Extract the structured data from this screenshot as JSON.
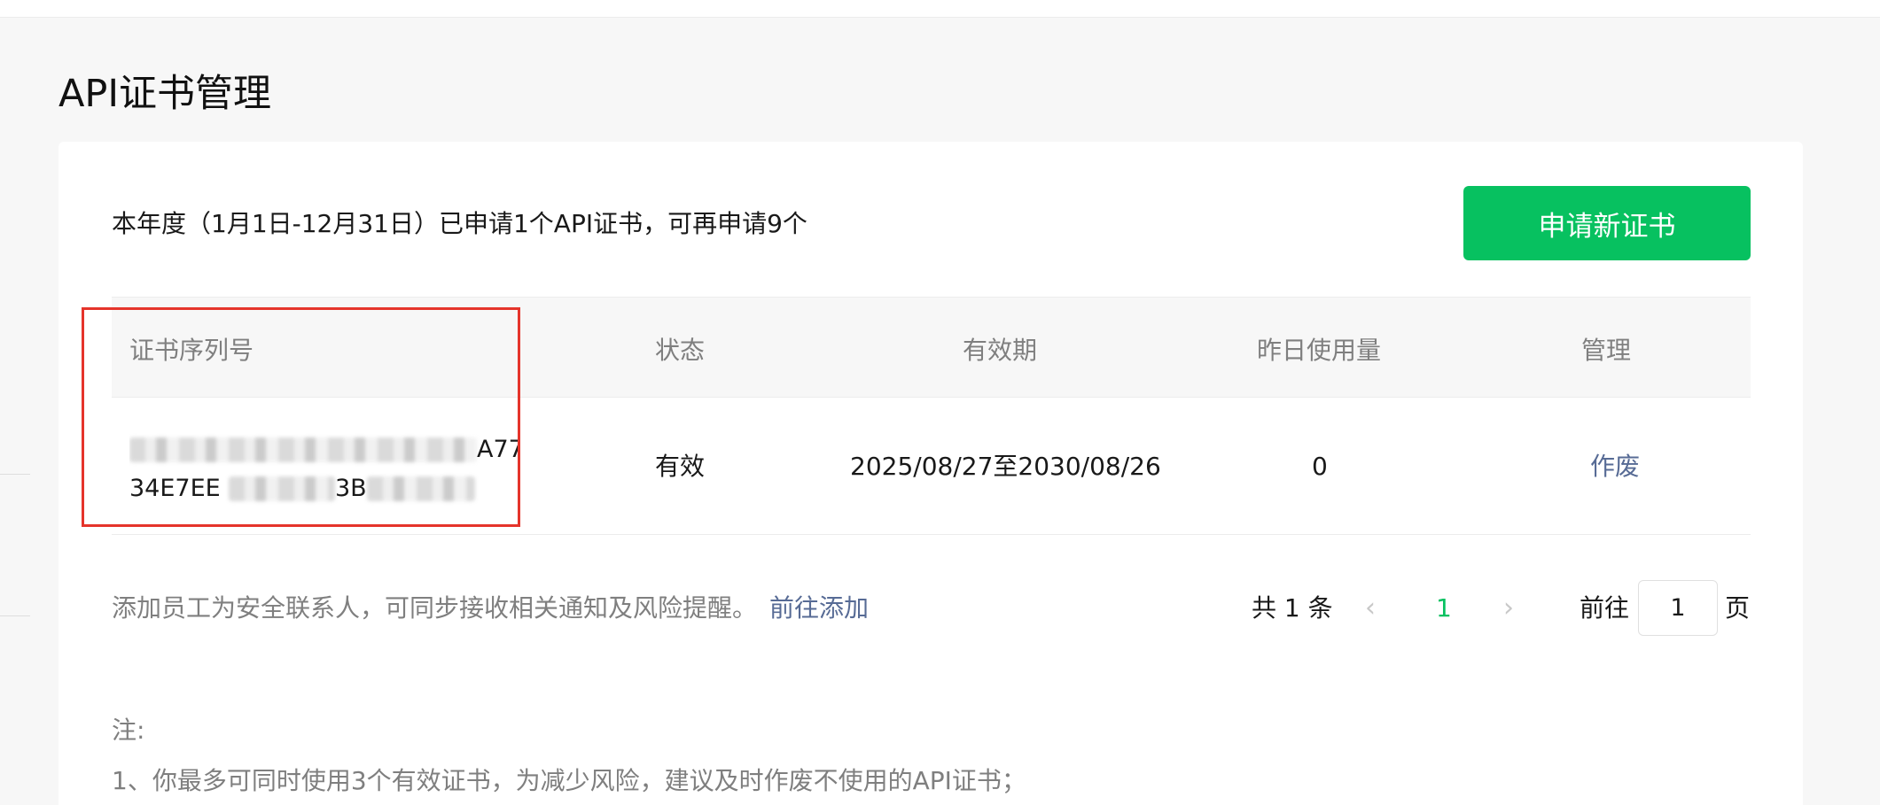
{
  "page": {
    "title": "API证书管理"
  },
  "quota": {
    "text": "本年度（1月1日-12月31日）已申请1个API证书，可再申请9个"
  },
  "apply_button": {
    "label": "申请新证书"
  },
  "table": {
    "headers": [
      "证书序列号",
      "状态",
      "有效期",
      "昨日使用量",
      "管理"
    ],
    "rows": [
      {
        "serial_line1_visible_end": "A77",
        "serial_line2_visible_start": "34E7EE",
        "serial_line2_visible_mid": "3B",
        "status": "有效",
        "validity": "2025/08/27至2030/08/26",
        "usage_yesterday": "0",
        "action": "作废"
      }
    ]
  },
  "contact": {
    "text": "添加员工为安全联系人，可同步接收相关通知及风险提醒。",
    "link": "前往添加"
  },
  "pagination": {
    "total_prefix": "共",
    "total": "1",
    "total_suffix": "条",
    "current_page": "1",
    "goto_label": "前往",
    "goto_value": "1",
    "page_suffix": "页"
  },
  "notes": {
    "label": "注:",
    "items": [
      "1、你最多可同时使用3个有效证书，为减少风险，建议及时作废不使用的API证书；"
    ]
  },
  "colors": {
    "accent": "#07c160",
    "link": "#576b95",
    "highlight": "#e5342b"
  }
}
